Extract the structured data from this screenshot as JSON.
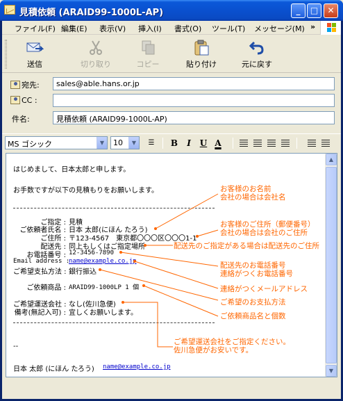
{
  "window": {
    "title": "見積依頼 (ARAID99-1000L-AP)"
  },
  "menu": [
    "ファイル(F)",
    "編集(E)",
    "表示(V)",
    "挿入(I)",
    "書式(O)",
    "ツール(T)",
    "メッセージ(M)"
  ],
  "toolbar": {
    "send": "送信",
    "cut": "切り取り",
    "copy": "コピー",
    "paste": "貼り付け",
    "undo": "元に戻す"
  },
  "header": {
    "to_label": "宛先:",
    "to_value": "sales@able.hans.or.jp",
    "cc_label": "CC :",
    "cc_value": "",
    "subject_label": "件名:",
    "subject_value": "見積依頼 (ARAID99-1000L-AP)"
  },
  "format": {
    "font": "MS ゴシック",
    "size": "10"
  },
  "message": {
    "greeting": "はじめまして、日本太郎と申します。",
    "request": "お手数ですが以下の見積もりをお願いします。",
    "rows": [
      {
        "label": "ご指定 :",
        "value": "見積"
      },
      {
        "label": "ご依頼者氏名 :",
        "value": "日本 太郎(にほん たろう)"
      },
      {
        "label": "ご住所 :",
        "value": "〒123-4567　東京都〇〇〇区〇〇〇1-1"
      },
      {
        "label": "配送先 :",
        "value": "同上もしくはご指定場所"
      },
      {
        "label": "お電話番号 :",
        "value": "12-3456-7890"
      },
      {
        "label": "Email address :",
        "value": "name@example.co.jp"
      },
      {
        "label": "ご希望支払方法 :",
        "value": "銀行振込"
      },
      {
        "label": "ご依頼商品 :",
        "value": "ARAID99-1000LP 1 個"
      },
      {
        "label": "ご希望運送会社 :",
        "value": "なし(佐川急便)"
      },
      {
        "label": "備考(無記入可) :",
        "value": "宜しくお願いします。"
      }
    ],
    "sig_sep": "--",
    "signature": "日本 太郎 (にほん たろう)",
    "signature_email": "name@example.co.jp"
  },
  "annotations": {
    "name1": "お客様のお名前",
    "name2": "会社の場合は会社名",
    "addr1": "お客様のご住所（郵便番号）",
    "addr2": "会社の場合は会社のご住所",
    "ship": "配送先のご指定がある場合は配送先のご住所",
    "phone1": "配送先のお電話番号",
    "phone2": "連絡がつくお電話番号",
    "email": "連絡がつくメールアドレス",
    "pay": "ご希望のお支払方法",
    "product": "ご依頼商品名と個数",
    "carrier1": "ご希望運送会社をご指定ください。",
    "carrier2": "佐川急便がお安いです。"
  },
  "colors": {
    "annotation": "#ff6600",
    "titlebar": "#0a50cf"
  }
}
